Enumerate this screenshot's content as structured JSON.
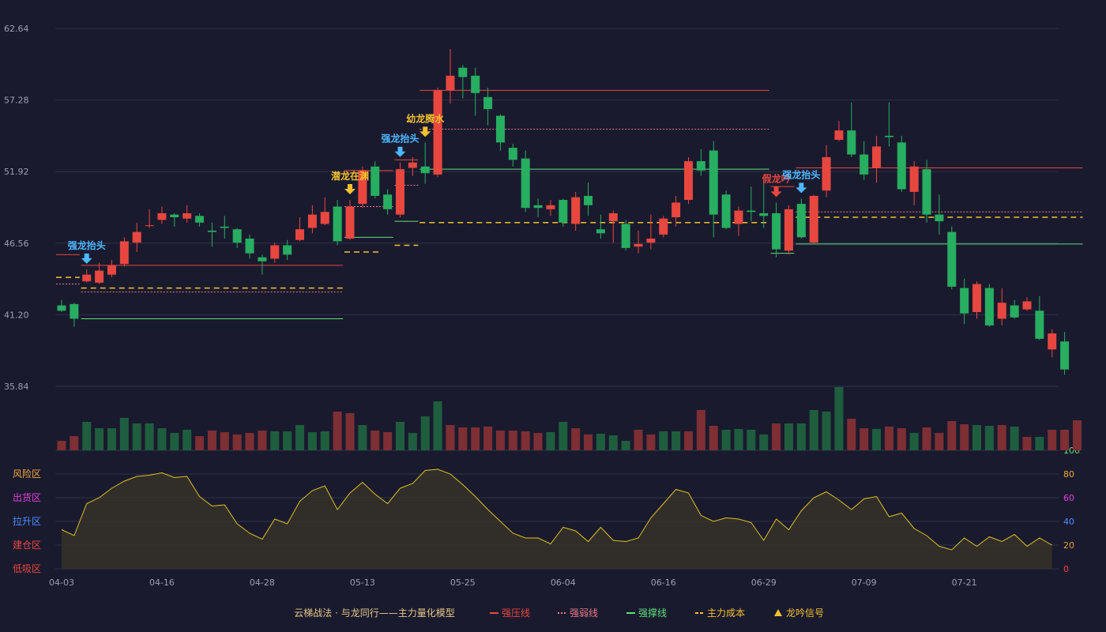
{
  "colors": {
    "background": "#1a1a2e",
    "up": "#e8473f",
    "down": "#27ae60",
    "vol_up": "#7d2f33",
    "vol_down": "#1e5e3e",
    "pressure": "#e8473f",
    "weak": "#e87a8a",
    "support": "#5ee07a",
    "cost": "#f2c12e",
    "signal_blue": "#4db8ff",
    "signal_gold": "#f2c12e",
    "signal_red": "#e8473f",
    "osc_line": "#e0c020",
    "grid": "#2f3149",
    "axis_text": "#9aa0b0"
  },
  "chart_data": {
    "type": "candlestick",
    "y_ticks": [
      "62.64",
      "57.28",
      "51.92",
      "46.56",
      "41.20",
      "35.84"
    ],
    "ylim": [
      35.84,
      62.64
    ],
    "x_ticks": [
      {
        "idx": 0,
        "label": "04-03"
      },
      {
        "idx": 8,
        "label": "04-16"
      },
      {
        "idx": 16,
        "label": "04-28"
      },
      {
        "idx": 24,
        "label": "05-13"
      },
      {
        "idx": 32,
        "label": "05-25"
      },
      {
        "idx": 40,
        "label": "06-04"
      },
      {
        "idx": 48,
        "label": "06-16"
      },
      {
        "idx": 56,
        "label": "06-29"
      },
      {
        "idx": 64,
        "label": "07-09"
      },
      {
        "idx": 72,
        "label": "07-21"
      }
    ],
    "candles": [
      [
        41.9,
        41.5,
        42.3,
        41.4
      ],
      [
        42.0,
        40.9,
        42.1,
        40.3
      ],
      [
        43.7,
        44.2,
        44.6,
        43.6
      ],
      [
        43.6,
        44.5,
        45.1,
        43.5
      ],
      [
        44.2,
        44.9,
        45.3,
        44.0
      ],
      [
        45.0,
        46.7,
        47.0,
        44.8
      ],
      [
        46.6,
        47.4,
        48.1,
        45.9
      ],
      [
        47.9,
        47.9,
        49.1,
        47.7
      ],
      [
        48.3,
        48.8,
        49.3,
        48.0
      ],
      [
        48.7,
        48.5,
        48.8,
        47.8
      ],
      [
        48.4,
        48.8,
        49.4,
        48.1
      ],
      [
        48.6,
        48.1,
        48.8,
        47.8
      ],
      [
        47.5,
        47.4,
        48.1,
        46.3
      ],
      [
        47.8,
        47.7,
        48.6,
        46.9
      ],
      [
        47.6,
        46.6,
        47.7,
        46.2
      ],
      [
        46.9,
        45.8,
        47.2,
        45.4
      ],
      [
        45.5,
        45.2,
        45.7,
        44.2
      ],
      [
        45.4,
        46.4,
        46.6,
        45.1
      ],
      [
        46.4,
        45.7,
        46.8,
        45.3
      ],
      [
        46.8,
        47.6,
        48.5,
        46.7
      ],
      [
        47.7,
        48.7,
        49.4,
        47.3
      ],
      [
        48.0,
        48.9,
        50.0,
        47.9
      ],
      [
        49.3,
        46.7,
        49.8,
        46.4
      ],
      [
        46.9,
        49.3,
        49.8,
        46.8
      ],
      [
        49.5,
        52.0,
        52.3,
        49.2
      ],
      [
        52.3,
        50.1,
        52.7,
        49.9
      ],
      [
        50.2,
        49.1,
        50.6,
        48.7
      ],
      [
        48.7,
        52.1,
        52.6,
        48.5
      ],
      [
        52.2,
        52.6,
        53.0,
        51.6
      ],
      [
        52.3,
        51.8,
        54.1,
        51.0
      ],
      [
        51.7,
        58.0,
        58.2,
        51.5
      ],
      [
        58.0,
        59.1,
        61.1,
        57.0
      ],
      [
        59.7,
        59.0,
        59.9,
        57.4
      ],
      [
        59.1,
        57.8,
        59.7,
        56.1
      ],
      [
        57.5,
        56.6,
        58.2,
        55.4
      ],
      [
        56.1,
        54.1,
        56.2,
        53.5
      ],
      [
        53.7,
        52.8,
        54.0,
        52.3
      ],
      [
        52.9,
        49.2,
        53.5,
        48.9
      ],
      [
        49.4,
        49.2,
        49.9,
        48.5
      ],
      [
        49.1,
        49.4,
        49.8,
        48.6
      ],
      [
        49.8,
        48.1,
        49.9,
        47.8
      ],
      [
        48.0,
        50.0,
        50.4,
        47.5
      ],
      [
        50.1,
        49.4,
        51.1,
        48.6
      ],
      [
        47.6,
        47.3,
        48.7,
        46.9
      ],
      [
        48.2,
        48.8,
        49.0,
        46.6
      ],
      [
        48.0,
        46.2,
        48.3,
        46.0
      ],
      [
        46.3,
        46.5,
        47.5,
        45.8
      ],
      [
        46.6,
        46.9,
        48.7,
        46.1
      ],
      [
        47.2,
        48.4,
        48.6,
        47.0
      ],
      [
        48.5,
        49.6,
        50.1,
        47.8
      ],
      [
        49.8,
        52.7,
        53.0,
        49.5
      ],
      [
        52.7,
        52.0,
        53.6,
        51.6
      ],
      [
        53.5,
        48.7,
        54.2,
        47.0
      ],
      [
        50.2,
        47.7,
        50.5,
        47.6
      ],
      [
        48.0,
        49.0,
        49.3,
        47.1
      ],
      [
        49.0,
        48.9,
        50.8,
        48.2
      ],
      [
        48.8,
        48.6,
        51.2,
        47.7
      ],
      [
        48.8,
        46.1,
        49.6,
        45.5
      ],
      [
        46.0,
        49.1,
        49.4,
        45.7
      ],
      [
        49.5,
        47.0,
        49.9,
        46.9
      ],
      [
        46.6,
        50.1,
        50.2,
        46.5
      ],
      [
        50.5,
        53.0,
        53.9,
        50.0
      ],
      [
        54.3,
        55.0,
        55.7,
        54.2
      ],
      [
        55.0,
        53.2,
        57.1,
        53.0
      ],
      [
        53.2,
        51.7,
        54.2,
        51.3
      ],
      [
        52.2,
        53.8,
        54.6,
        51.1
      ],
      [
        54.6,
        54.5,
        57.1,
        53.8
      ],
      [
        54.1,
        50.6,
        54.6,
        50.4
      ],
      [
        50.4,
        52.3,
        52.7,
        49.4
      ],
      [
        52.1,
        48.7,
        52.8,
        48.1
      ],
      [
        48.7,
        48.2,
        50.2,
        47.2
      ],
      [
        47.4,
        43.3,
        47.8,
        43.1
      ],
      [
        43.2,
        41.3,
        43.9,
        40.5
      ],
      [
        41.4,
        43.5,
        43.7,
        40.9
      ],
      [
        43.2,
        40.4,
        43.5,
        40.3
      ],
      [
        40.9,
        42.1,
        43.2,
        40.4
      ],
      [
        41.9,
        41.0,
        42.3,
        40.9
      ],
      [
        41.6,
        42.2,
        42.5,
        41.5
      ],
      [
        41.5,
        39.4,
        42.6,
        39.3
      ],
      [
        38.6,
        39.8,
        40.1,
        38.0
      ],
      [
        39.2,
        37.1,
        39.9,
        36.7
      ]
    ],
    "volumes": [
      [
        12,
        1
      ],
      [
        18,
        1
      ],
      [
        36,
        0
      ],
      [
        28,
        0
      ],
      [
        28,
        0
      ],
      [
        41,
        0
      ],
      [
        34,
        0
      ],
      [
        34,
        0
      ],
      [
        28,
        0
      ],
      [
        22,
        0
      ],
      [
        26,
        0
      ],
      [
        18,
        1
      ],
      [
        25,
        1
      ],
      [
        23,
        1
      ],
      [
        20,
        1
      ],
      [
        22,
        1
      ],
      [
        25,
        1
      ],
      [
        24,
        0
      ],
      [
        24,
        0
      ],
      [
        32,
        0
      ],
      [
        23,
        0
      ],
      [
        24,
        0
      ],
      [
        49,
        1
      ],
      [
        47,
        1
      ],
      [
        32,
        0
      ],
      [
        25,
        1
      ],
      [
        23,
        1
      ],
      [
        36,
        0
      ],
      [
        22,
        0
      ],
      [
        43,
        0
      ],
      [
        62,
        0
      ],
      [
        32,
        1
      ],
      [
        29,
        1
      ],
      [
        29,
        1
      ],
      [
        30,
        1
      ],
      [
        25,
        1
      ],
      [
        25,
        1
      ],
      [
        24,
        1
      ],
      [
        22,
        1
      ],
      [
        23,
        0
      ],
      [
        36,
        0
      ],
      [
        28,
        1
      ],
      [
        20,
        1
      ],
      [
        21,
        0
      ],
      [
        19,
        0
      ],
      [
        12,
        0
      ],
      [
        26,
        1
      ],
      [
        20,
        1
      ],
      [
        24,
        0
      ],
      [
        24,
        0
      ],
      [
        24,
        1
      ],
      [
        51,
        1
      ],
      [
        31,
        1
      ],
      [
        26,
        0
      ],
      [
        27,
        0
      ],
      [
        26,
        0
      ],
      [
        20,
        0
      ],
      [
        34,
        1
      ],
      [
        34,
        0
      ],
      [
        34,
        0
      ],
      [
        51,
        0
      ],
      [
        49,
        0
      ],
      [
        80,
        0
      ],
      [
        40,
        1
      ],
      [
        28,
        1
      ],
      [
        27,
        0
      ],
      [
        30,
        1
      ],
      [
        28,
        1
      ],
      [
        22,
        0
      ],
      [
        29,
        1
      ],
      [
        22,
        1
      ],
      [
        37,
        1
      ],
      [
        33,
        1
      ],
      [
        32,
        0
      ],
      [
        31,
        0
      ],
      [
        32,
        1
      ],
      [
        30,
        0
      ],
      [
        17,
        1
      ],
      [
        17,
        0
      ],
      [
        26,
        1
      ],
      [
        26,
        1
      ],
      [
        38,
        1
      ]
    ],
    "oscillator": [
      33,
      28,
      55,
      60,
      68,
      74,
      78,
      79,
      81,
      77,
      78,
      61,
      53,
      54,
      38,
      30,
      25,
      42,
      38,
      57,
      66,
      70,
      50,
      64,
      73,
      63,
      55,
      68,
      72,
      83,
      84,
      80,
      71,
      61,
      50,
      40,
      30,
      26,
      26,
      21,
      35,
      32,
      23,
      35,
      24,
      23,
      26,
      43,
      55,
      67,
      64,
      45,
      40,
      43,
      42,
      39,
      24,
      42,
      33,
      49,
      60,
      65,
      58,
      50,
      59,
      61,
      44,
      47,
      34,
      28,
      19,
      16,
      26,
      19,
      27,
      23,
      29,
      19,
      26,
      20
    ],
    "osc_ticks": [
      "100",
      "80",
      "60",
      "40",
      "20",
      "0"
    ],
    "osc_zones": [
      "风险区",
      "出货区",
      "拉升区",
      "建仓区",
      "低吸区"
    ],
    "signals": [
      {
        "idx": 2,
        "label": "强龙抬头",
        "type": "blue"
      },
      {
        "idx": 23,
        "label": "潜龙在渊",
        "type": "gold"
      },
      {
        "idx": 27,
        "label": "强龙抬头",
        "type": "blue"
      },
      {
        "idx": 29,
        "label": "幼龙腾水",
        "type": "gold"
      },
      {
        "idx": 57,
        "label": "假龙吟",
        "type": "red"
      },
      {
        "idx": 59,
        "label": "强龙抬头",
        "type": "blue"
      }
    ],
    "levels": [
      {
        "type": "pressure",
        "from": 2,
        "to": 22,
        "value": 44.9
      },
      {
        "type": "weak",
        "from": 2,
        "to": 22,
        "value": 42.9
      },
      {
        "type": "cost",
        "from": 2,
        "to": 22,
        "value": 43.2
      },
      {
        "type": "support",
        "from": 2,
        "to": 22,
        "value": 40.9
      },
      {
        "type": "pressure",
        "from": 0,
        "to": 1,
        "value": 45.7
      },
      {
        "type": "cost",
        "from": 0,
        "to": 1,
        "value": 44.0
      },
      {
        "type": "weak",
        "from": 0,
        "to": 1,
        "value": 43.5
      },
      {
        "type": "cost",
        "from": 23,
        "to": 25,
        "value": 45.9
      },
      {
        "type": "support",
        "from": 23,
        "to": 26,
        "value": 47.0
      },
      {
        "type": "pressure",
        "from": 23,
        "to": 26,
        "value": 52.0
      },
      {
        "type": "weak",
        "from": 23,
        "to": 26,
        "value": 49.3
      },
      {
        "type": "pressure",
        "from": 27,
        "to": 28,
        "value": 52.8
      },
      {
        "type": "weak",
        "from": 27,
        "to": 28,
        "value": 50.9
      },
      {
        "type": "support",
        "from": 27,
        "to": 28,
        "value": 48.2
      },
      {
        "type": "cost",
        "from": 27,
        "to": 28,
        "value": 46.4
      },
      {
        "type": "pressure",
        "from": 29,
        "to": 56,
        "value": 58.0
      },
      {
        "type": "weak",
        "from": 29,
        "to": 56,
        "value": 55.1
      },
      {
        "type": "support",
        "from": 29,
        "to": 56,
        "value": 52.1
      },
      {
        "type": "cost",
        "from": 29,
        "to": 56,
        "value": 48.1
      },
      {
        "type": "pressure",
        "from": 57,
        "to": 58,
        "value": 50.8
      },
      {
        "type": "support",
        "from": 57,
        "to": 58,
        "value": 45.8
      },
      {
        "type": "pressure",
        "from": 59,
        "to": 81,
        "value": 52.2
      },
      {
        "type": "weak",
        "from": 59,
        "to": 81,
        "value": 48.9
      },
      {
        "type": "cost",
        "from": 59,
        "to": 81,
        "value": 48.5
      },
      {
        "type": "support",
        "from": 59,
        "to": 81,
        "value": 46.5
      }
    ]
  },
  "legend": {
    "title": "云梯战法 · 与龙同行——主力量化模型",
    "items": [
      {
        "type": "pressure",
        "label": "强压线"
      },
      {
        "type": "weak",
        "label": "强弱线"
      },
      {
        "type": "support",
        "label": "强撑线"
      },
      {
        "type": "cost",
        "label": "主力成本"
      },
      {
        "type": "signal",
        "label": "龙吟信号"
      }
    ]
  }
}
